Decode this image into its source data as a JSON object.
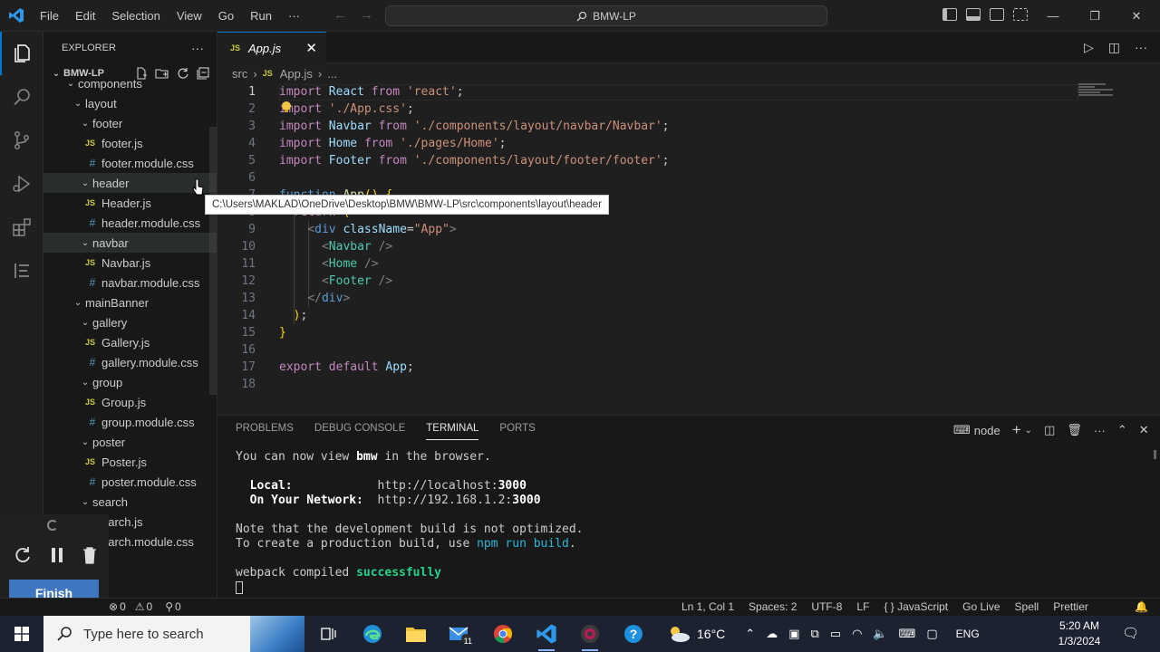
{
  "titlebar": {
    "menu": [
      "File",
      "Edit",
      "Selection",
      "View",
      "Go",
      "Run",
      "···"
    ],
    "search_text": "BMW-LP"
  },
  "explorer": {
    "header": "EXPLORER",
    "more": "···",
    "project": "BMW-LP",
    "tree": [
      {
        "label": "components",
        "kind": "folder",
        "indent": 0
      },
      {
        "label": "layout",
        "kind": "folder",
        "indent": 1
      },
      {
        "label": "footer",
        "kind": "folder",
        "indent": 2
      },
      {
        "label": "footer.js",
        "kind": "js",
        "indent": 3
      },
      {
        "label": "footer.module.css",
        "kind": "css",
        "indent": 3
      },
      {
        "label": "header",
        "kind": "folder",
        "indent": 2
      },
      {
        "label": "Header.js",
        "kind": "js",
        "indent": 3
      },
      {
        "label": "header.module.css",
        "kind": "css",
        "indent": 3
      },
      {
        "label": "navbar",
        "kind": "folder",
        "indent": 2
      },
      {
        "label": "Navbar.js",
        "kind": "js",
        "indent": 3
      },
      {
        "label": "navbar.module.css",
        "kind": "css",
        "indent": 3
      },
      {
        "label": "mainBanner",
        "kind": "folder",
        "indent": 1
      },
      {
        "label": "gallery",
        "kind": "folder",
        "indent": 2
      },
      {
        "label": "Gallery.js",
        "kind": "js",
        "indent": 3
      },
      {
        "label": "gallery.module.css",
        "kind": "css",
        "indent": 3
      },
      {
        "label": "group",
        "kind": "folder",
        "indent": 2
      },
      {
        "label": "Group.js",
        "kind": "js",
        "indent": 3
      },
      {
        "label": "group.module.css",
        "kind": "css",
        "indent": 3
      },
      {
        "label": "poster",
        "kind": "folder",
        "indent": 2
      },
      {
        "label": "Poster.js",
        "kind": "js",
        "indent": 3
      },
      {
        "label": "poster.module.css",
        "kind": "css",
        "indent": 3
      },
      {
        "label": "search",
        "kind": "folder",
        "indent": 2
      },
      {
        "label": "earch.js",
        "kind": "js",
        "indent": 3
      },
      {
        "label": "earch.module.css",
        "kind": "css",
        "indent": 3
      }
    ],
    "tooltip": "C:\\Users\\MAKLAD\\OneDrive\\Desktop\\BMW\\BMW-LP\\src\\components\\layout\\header"
  },
  "recorder": {
    "finish_label": "Finish"
  },
  "editor": {
    "tab_label": "App.js",
    "tab_badge": "JS",
    "breadcrumb": [
      "src",
      "App.js",
      "..."
    ],
    "lines": [
      {
        "n": "1",
        "code": [
          [
            "k",
            "import"
          ],
          [
            "p",
            " "
          ],
          [
            "v",
            "React"
          ],
          [
            "p",
            " "
          ],
          [
            "k",
            "from"
          ],
          [
            "p",
            " "
          ],
          [
            "s",
            "'react'"
          ],
          [
            "p",
            ";"
          ]
        ]
      },
      {
        "n": "2",
        "code": [
          [
            "k",
            "import"
          ],
          [
            "p",
            " "
          ],
          [
            "s",
            "'./App.css'"
          ],
          [
            "p",
            ";"
          ]
        ]
      },
      {
        "n": "3",
        "code": [
          [
            "k",
            "import"
          ],
          [
            "p",
            " "
          ],
          [
            "v",
            "Navbar"
          ],
          [
            "p",
            " "
          ],
          [
            "k",
            "from"
          ],
          [
            "p",
            " "
          ],
          [
            "s",
            "'./components/layout/navbar/Navbar'"
          ],
          [
            "p",
            ";"
          ]
        ]
      },
      {
        "n": "4",
        "code": [
          [
            "k",
            "import"
          ],
          [
            "p",
            " "
          ],
          [
            "v",
            "Home"
          ],
          [
            "p",
            " "
          ],
          [
            "k",
            "from"
          ],
          [
            "p",
            " "
          ],
          [
            "s",
            "'./pages/Home'"
          ],
          [
            "p",
            ";"
          ]
        ]
      },
      {
        "n": "5",
        "code": [
          [
            "k",
            "import"
          ],
          [
            "p",
            " "
          ],
          [
            "v",
            "Footer"
          ],
          [
            "p",
            " "
          ],
          [
            "k",
            "from"
          ],
          [
            "p",
            " "
          ],
          [
            "s",
            "'./components/layout/footer/footer'"
          ],
          [
            "p",
            ";"
          ]
        ]
      },
      {
        "n": "6",
        "code": []
      },
      {
        "n": "7",
        "code": [
          [
            "t",
            "function"
          ],
          [
            "p",
            " "
          ],
          [
            "f",
            "App"
          ],
          [
            "b",
            "()"
          ],
          [
            "p",
            " "
          ],
          [
            "b",
            "{"
          ]
        ]
      },
      {
        "n": "8",
        "code": [
          [
            "p",
            "  "
          ],
          [
            "k",
            "return"
          ],
          [
            "p",
            " "
          ],
          [
            "b",
            "("
          ]
        ]
      },
      {
        "n": "9",
        "code": [
          [
            "p",
            "    "
          ],
          [
            "g",
            "<"
          ],
          [
            "t",
            "div"
          ],
          [
            "p",
            " "
          ],
          [
            "v",
            "className"
          ],
          [
            "p",
            "="
          ],
          [
            "s",
            "\"App\""
          ],
          [
            "g",
            ">"
          ]
        ]
      },
      {
        "n": "10",
        "code": [
          [
            "p",
            "      "
          ],
          [
            "g",
            "<"
          ],
          [
            "c",
            "Navbar"
          ],
          [
            "p",
            " "
          ],
          [
            "g",
            "/>"
          ]
        ]
      },
      {
        "n": "11",
        "code": [
          [
            "p",
            "      "
          ],
          [
            "g",
            "<"
          ],
          [
            "c",
            "Home"
          ],
          [
            "p",
            " "
          ],
          [
            "g",
            "/>"
          ]
        ]
      },
      {
        "n": "12",
        "code": [
          [
            "p",
            "      "
          ],
          [
            "g",
            "<"
          ],
          [
            "c",
            "Footer"
          ],
          [
            "p",
            " "
          ],
          [
            "g",
            "/>"
          ]
        ]
      },
      {
        "n": "13",
        "code": [
          [
            "p",
            "    "
          ],
          [
            "g",
            "</"
          ],
          [
            "t",
            "div"
          ],
          [
            "g",
            ">"
          ]
        ]
      },
      {
        "n": "14",
        "code": [
          [
            "p",
            "  "
          ],
          [
            "b",
            ")"
          ],
          [
            "p",
            ";"
          ]
        ]
      },
      {
        "n": "15",
        "code": [
          [
            "b",
            "}"
          ]
        ]
      },
      {
        "n": "16",
        "code": []
      },
      {
        "n": "17",
        "code": [
          [
            "k",
            "export"
          ],
          [
            "p",
            " "
          ],
          [
            "k",
            "default"
          ],
          [
            "p",
            " "
          ],
          [
            "v",
            "App"
          ],
          [
            "p",
            ";"
          ]
        ]
      },
      {
        "n": "18",
        "code": []
      }
    ]
  },
  "panel": {
    "tabs": [
      "PROBLEMS",
      "DEBUG CONSOLE",
      "TERMINAL",
      "PORTS"
    ],
    "active_tab": "TERMINAL",
    "shell": "node",
    "terminal": {
      "l1a": "You can now view ",
      "l1b": "bmw",
      "l1c": " in the browser.",
      "local_label": "Local:",
      "local_url_a": "http://localhost:",
      "local_port": "3000",
      "net_label": "On Your Network:",
      "net_url_a": "http://192.168.1.2:",
      "net_port": "3000",
      "note1": "Note that the development build is not optimized.",
      "note2a": "To create a production build, use ",
      "note2b": "npm run build",
      "note2c": ".",
      "wp_a": "webpack compiled ",
      "wp_b": "successfully"
    }
  },
  "status": {
    "errors": "0",
    "warnings": "0",
    "ports": "0",
    "right": [
      "Ln 1, Col 1",
      "Spaces: 2",
      "UTF-8",
      "LF",
      "{ } JavaScript",
      "Go Live",
      "Spell",
      "Prettier"
    ]
  },
  "taskbar": {
    "search_placeholder": "Type here to search",
    "mail_badge": "11",
    "weather": "16°C",
    "lang": "ENG",
    "time": "5:20 AM",
    "date": "1/3/2024"
  }
}
